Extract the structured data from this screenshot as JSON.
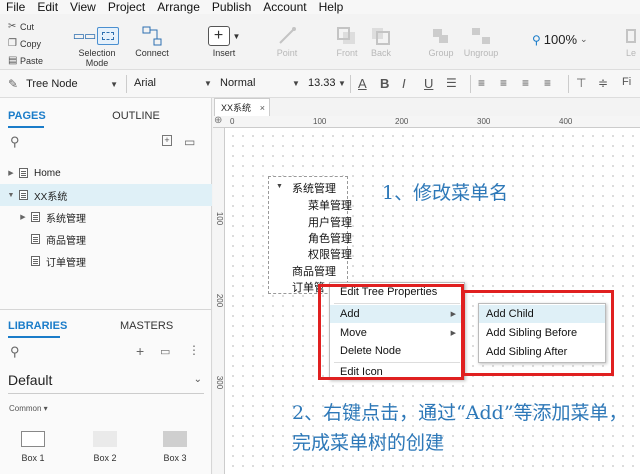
{
  "menu": [
    "File",
    "Edit",
    "View",
    "Project",
    "Arrange",
    "Publish",
    "Account",
    "Help"
  ],
  "clipboard": {
    "cut": "Cut",
    "copy": "Copy",
    "paste": "Paste"
  },
  "toolbar": {
    "selection_mode": "Selection Mode",
    "connect": "Connect",
    "insert": "Insert",
    "point": "Point",
    "front": "Front",
    "back": "Back",
    "group": "Group",
    "ungroup": "Ungroup",
    "zoom": "100%",
    "overflow": "Le"
  },
  "format": {
    "widget_type": "Tree Node",
    "font": "Arial",
    "style": "Normal",
    "size": "13.33",
    "bold": "B",
    "italic": "I",
    "underline": "U",
    "overflow": "Fi"
  },
  "pages_panel": {
    "tab_pages": "PAGES",
    "tab_outline": "OUTLINE",
    "items": [
      {
        "label": "Home",
        "level": 0,
        "expander": "right"
      },
      {
        "label": "XX系统",
        "level": 0,
        "expander": "down",
        "active": true
      },
      {
        "label": "系统管理",
        "level": 1,
        "expander": "right"
      },
      {
        "label": "商品管理",
        "level": 1,
        "expander": ""
      },
      {
        "label": "订单管理",
        "level": 1,
        "expander": ""
      }
    ]
  },
  "libraries_panel": {
    "tab_libraries": "LIBRARIES",
    "tab_masters": "MASTERS",
    "library": "Default",
    "category": "Common ▾",
    "boxes": [
      "Box 1",
      "Box 2",
      "Box 3"
    ]
  },
  "document_tab": {
    "label": "XX系统",
    "close": "×"
  },
  "ruler": {
    "h_ticks": [
      "0",
      "100",
      "200",
      "300",
      "400"
    ],
    "v_ticks": [
      "100",
      "200",
      "300"
    ]
  },
  "tree": {
    "nodes": [
      "系统管理",
      "菜单管理",
      "用户管理",
      "角色管理",
      "权限管理",
      "商品管理",
      "订单管"
    ],
    "expander": "▼"
  },
  "annotations": {
    "step1": "1、修改菜单名",
    "step2": "2、右键点击，通过“Add”等添加菜单，完成菜单树的创建"
  },
  "context_menu": {
    "items": [
      "Edit Tree Properties",
      "Add",
      "Move",
      "Delete Node",
      "Edit Icon"
    ],
    "submenu": [
      "Add Child",
      "Add Sibling Before",
      "Add Sibling After"
    ]
  },
  "colors": {
    "accent": "#1a7cc9",
    "highlight": "#e02020",
    "annotation": "#2d78b8"
  }
}
